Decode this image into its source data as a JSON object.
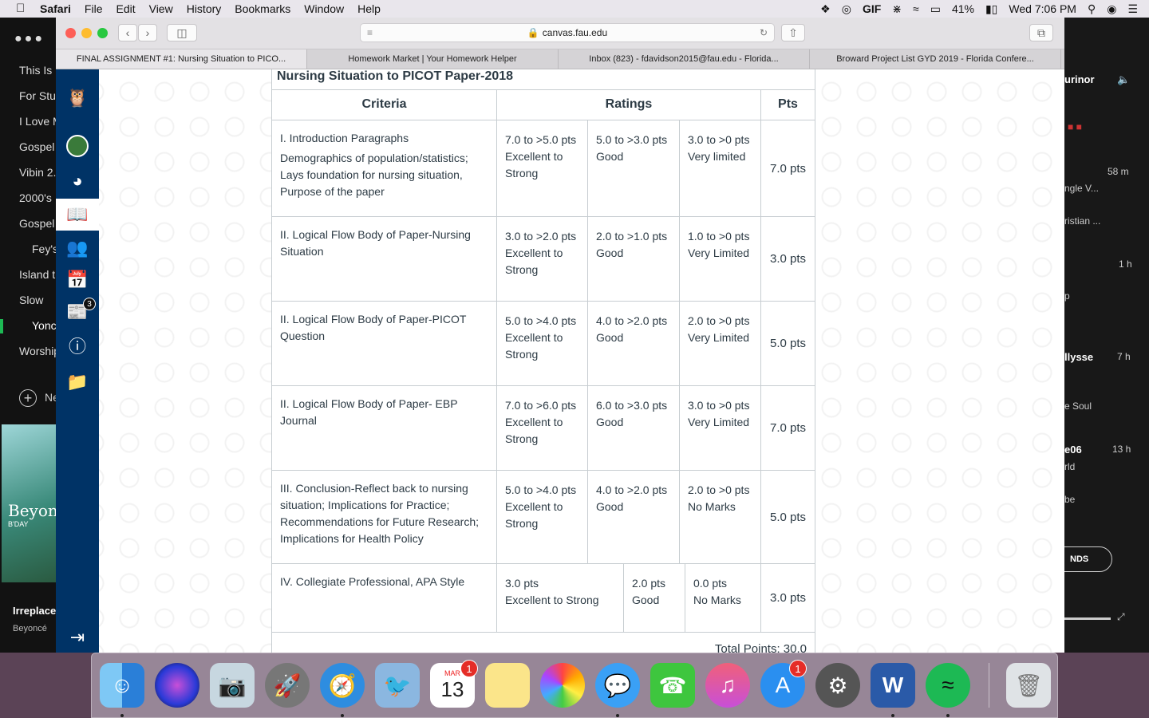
{
  "menubar": {
    "app": "Safari",
    "items": [
      "File",
      "Edit",
      "View",
      "History",
      "Bookmarks",
      "Window",
      "Help"
    ],
    "gif": "GIF",
    "battery": "41%",
    "clock": "Wed 7:06 PM"
  },
  "spotify": {
    "playlists": [
      "This Is",
      "For Stu",
      "I Love M",
      "Gospel",
      "Vibin 2.",
      "2000's",
      "Gospel",
      "Fey's",
      "Island t",
      "Slow",
      "Yonc",
      "Worship"
    ],
    "new_label": "Ne",
    "album_text": "Beyonc",
    "album_sub": "B'DAY",
    "now_title": "Irreplace",
    "now_artist": "Beyoncé",
    "right": {
      "r1": "urinor",
      "r2": "58 m",
      "r3": "ngle V...",
      "r4": "ristian ...",
      "r5": "1 h",
      "r6": "p",
      "r7": "llysse",
      "r8": "7 h",
      "r9": "e Soul",
      "r10": "e06",
      "r11": "13 h",
      "r12": "rld",
      "r13": "be",
      "btn": "NDS"
    }
  },
  "browser": {
    "url": "canvas.fau.edu",
    "tabs": [
      "FINAL ASSIGNMENT #1: Nursing Situation to PICO...",
      "Homework Market | Your Homework Helper",
      "Inbox (823) - fdavidson2015@fau.edu - Florida...",
      "Broward Project List GYD 2019 - Florida Confere..."
    ],
    "new_tab": "+"
  },
  "canvas_nav": {
    "badge": "3"
  },
  "rubric": {
    "title": "Nursing Situation to PICOT Paper-2018",
    "headers": {
      "criteria": "Criteria",
      "ratings": "Ratings",
      "pts": "Pts"
    },
    "rows": [
      {
        "crit_title": "I. Introduction Paragraphs",
        "crit_desc": "Demographics of population/statistics; Lays foundation for nursing situation, Purpose of the paper",
        "r1_pts": "7.0 to >5.0 pts",
        "r1_desc": "Excellent to Strong",
        "r2_pts": "5.0 to >3.0 pts",
        "r2_desc": "Good",
        "r3_pts": "3.0 to >0 pts",
        "r3_desc": "Very limited",
        "pts": "7.0 pts"
      },
      {
        "crit_title": "II. Logical Flow Body of Paper-Nursing Situation",
        "crit_desc": "",
        "r1_pts": "3.0 to >2.0 pts",
        "r1_desc": "Excellent to Strong",
        "r2_pts": "2.0 to >1.0 pts",
        "r2_desc": "Good",
        "r3_pts": "1.0 to >0 pts",
        "r3_desc": "Very Limited",
        "pts": "3.0 pts"
      },
      {
        "crit_title": "II. Logical Flow Body of Paper-PICOT Question",
        "crit_desc": "",
        "r1_pts": "5.0 to >4.0 pts",
        "r1_desc": "Excellent to Strong",
        "r2_pts": "4.0 to >2.0 pts",
        "r2_desc": "Good",
        "r3_pts": "2.0 to >0 pts",
        "r3_desc": "Very Limited",
        "pts": "5.0 pts"
      },
      {
        "crit_title": "II. Logical Flow Body of Paper- EBP Journal",
        "crit_desc": "",
        "r1_pts": "7.0 to >6.0 pts",
        "r1_desc": "Excellent to Strong",
        "r2_pts": "6.0 to >3.0 pts",
        "r2_desc": "Good",
        "r3_pts": "3.0 to >0 pts",
        "r3_desc": "Very Limited",
        "pts": "7.0 pts"
      },
      {
        "crit_title": "III. Conclusion-Reflect back to nursing situation; Implications for Practice; Recommendations for Future Research; Implications for Health Policy",
        "crit_desc": "",
        "r1_pts": "5.0 to >4.0 pts",
        "r1_desc": "Excellent to Strong",
        "r2_pts": "4.0 to >2.0 pts",
        "r2_desc": "Good",
        "r3_pts": "2.0 to >0 pts",
        "r3_desc": "No Marks",
        "pts": "5.0 pts"
      },
      {
        "crit_title": "IV. Collegiate Professional, APA Style",
        "crit_desc": "",
        "r1_pts": "3.0 pts",
        "r1_desc": "Excellent to Strong",
        "r2_pts": "2.0 pts",
        "r2_desc": "Good",
        "r3_pts": "0.0 pts",
        "r3_desc": "No Marks",
        "pts": "3.0 pts"
      }
    ],
    "total": "Total Points: 30.0"
  },
  "dock": {
    "calendar_month": "MAR",
    "calendar_day": "13",
    "calendar_badge": "1",
    "appstore_badge": "1",
    "word_letter": "W"
  }
}
